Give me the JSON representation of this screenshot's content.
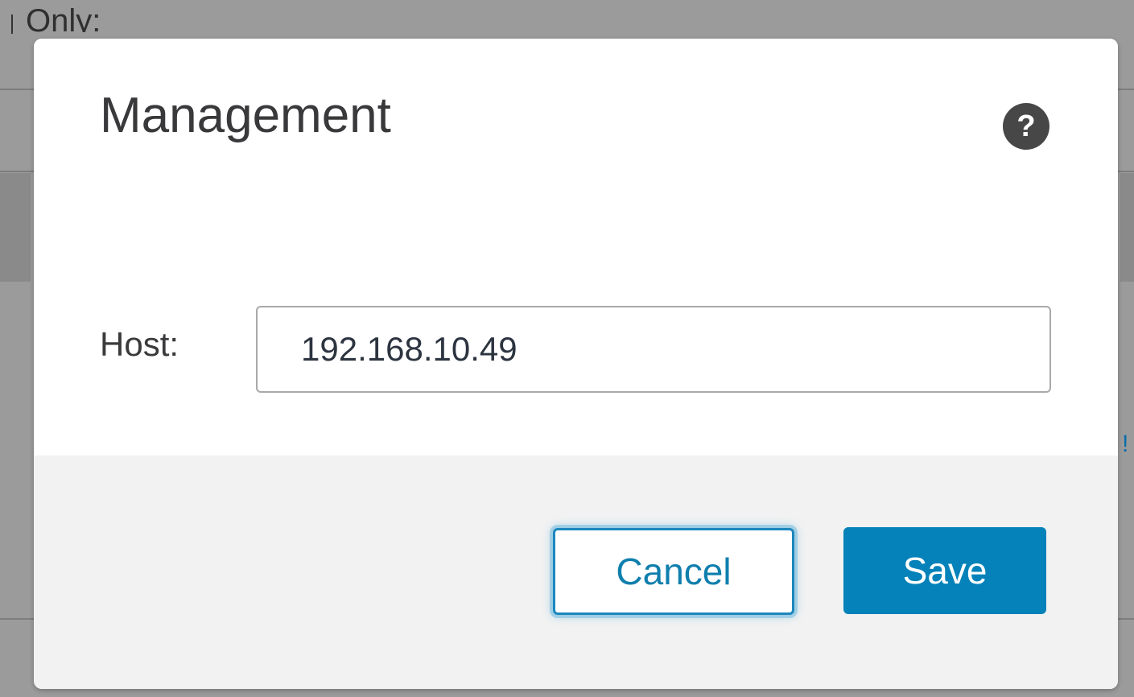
{
  "background": {
    "partial_text": "Only:"
  },
  "dialog": {
    "title": "Management",
    "help_icon": "question-mark-icon",
    "host": {
      "label": "Host:",
      "value": "192.168.10.49"
    },
    "buttons": {
      "cancel_label": "Cancel",
      "save_label": "Save"
    }
  },
  "colors": {
    "overlay": "#9b9b9b",
    "primary_button": "#0582b9",
    "cancel_text": "#0f7fae",
    "footer_bg": "#f2f2f2",
    "help_icon_bg": "#474747"
  }
}
